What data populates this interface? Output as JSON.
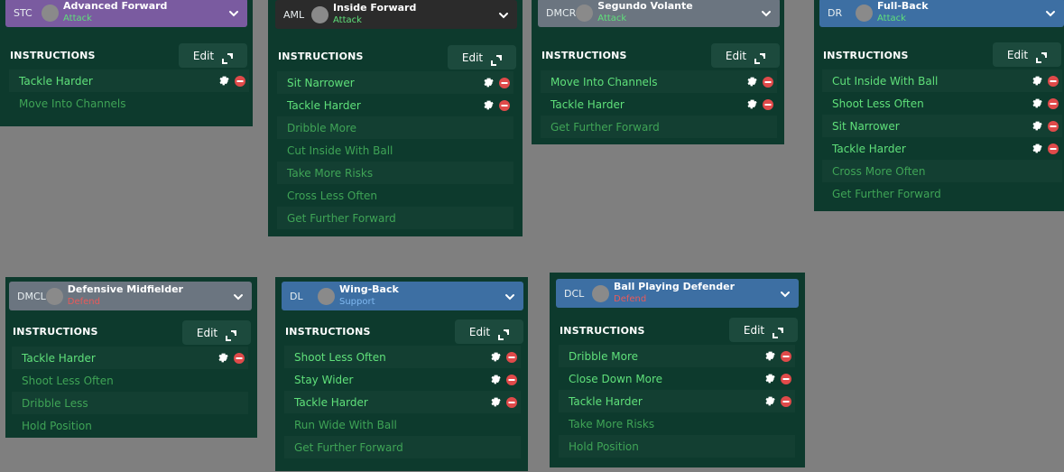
{
  "colors": {
    "attack": "#5fe07a",
    "support": "#7fb8f0",
    "defend": "#e85a5a",
    "active_instruction": "#5fe07a",
    "inactive_instruction": "#3fa456",
    "remove": "#e04a4a"
  },
  "icons": {
    "avatar": "player-avatar-icon",
    "chevron": "chevron-down-icon",
    "edit": "expand-icon",
    "settings": "gear-icon",
    "remove": "remove-icon"
  },
  "panels": [
    {
      "id": "stc",
      "position": "STC",
      "role": "Advanced Forward",
      "duty": "Attack",
      "duty_color": "#5fe07a",
      "header_color": "#7a5ba0",
      "instructions_label": "INSTRUCTIONS",
      "edit_label": "Edit",
      "instructions": [
        {
          "label": "Tackle Harder",
          "active": true
        },
        {
          "label": "Move Into Channels",
          "active": false
        }
      ]
    },
    {
      "id": "aml",
      "position": "AML",
      "role": "Inside Forward",
      "duty": "Attack",
      "duty_color": "#5fe07a",
      "header_color": "#2b2b2b",
      "instructions_label": "INSTRUCTIONS",
      "edit_label": "Edit",
      "instructions": [
        {
          "label": "Sit Narrower",
          "active": true
        },
        {
          "label": "Tackle Harder",
          "active": true
        },
        {
          "label": "Dribble More",
          "active": false
        },
        {
          "label": "Cut Inside With Ball",
          "active": false
        },
        {
          "label": "Take More Risks",
          "active": false
        },
        {
          "label": "Cross Less Often",
          "active": false
        },
        {
          "label": "Get Further Forward",
          "active": false
        }
      ]
    },
    {
      "id": "dmcr",
      "position": "DMCR",
      "role": "Segundo Volante",
      "duty": "Attack",
      "duty_color": "#5fe07a",
      "header_color": "#6b7580",
      "instructions_label": "INSTRUCTIONS",
      "edit_label": "Edit",
      "instructions": [
        {
          "label": "Move Into Channels",
          "active": true
        },
        {
          "label": "Tackle Harder",
          "active": true
        },
        {
          "label": "Get Further Forward",
          "active": false
        }
      ]
    },
    {
      "id": "dr",
      "position": "DR",
      "role": "Full-Back",
      "duty": "Attack",
      "duty_color": "#5fe07a",
      "header_color": "#3d6fa3",
      "instructions_label": "INSTRUCTIONS",
      "edit_label": "Edit",
      "instructions": [
        {
          "label": "Cut Inside With Ball",
          "active": true
        },
        {
          "label": "Shoot Less Often",
          "active": true
        },
        {
          "label": "Sit Narrower",
          "active": true
        },
        {
          "label": "Tackle Harder",
          "active": true
        },
        {
          "label": "Cross More Often",
          "active": false
        },
        {
          "label": "Get Further Forward",
          "active": false
        }
      ]
    },
    {
      "id": "dmcl",
      "position": "DMCL",
      "role": "Defensive Midfielder",
      "duty": "Defend",
      "duty_color": "#e85a5a",
      "header_color": "#6b7580",
      "instructions_label": "INSTRUCTIONS",
      "edit_label": "Edit",
      "instructions": [
        {
          "label": "Tackle Harder",
          "active": true
        },
        {
          "label": "Shoot Less Often",
          "active": false
        },
        {
          "label": "Dribble Less",
          "active": false
        },
        {
          "label": "Hold Position",
          "active": false
        }
      ]
    },
    {
      "id": "dl",
      "position": "DL",
      "role": "Wing-Back",
      "duty": "Support",
      "duty_color": "#7fb8f0",
      "header_color": "#3d6fa3",
      "instructions_label": "INSTRUCTIONS",
      "edit_label": "Edit",
      "instructions": [
        {
          "label": "Shoot Less Often",
          "active": true
        },
        {
          "label": "Stay Wider",
          "active": true
        },
        {
          "label": "Tackle Harder",
          "active": true
        },
        {
          "label": "Run Wide With Ball",
          "active": false
        },
        {
          "label": "Get Further Forward",
          "active": false
        }
      ]
    },
    {
      "id": "dcl",
      "position": "DCL",
      "role": "Ball Playing Defender",
      "duty": "Defend",
      "duty_color": "#e85a5a",
      "header_color": "#3d6fa3",
      "instructions_label": "INSTRUCTIONS",
      "edit_label": "Edit",
      "instructions": [
        {
          "label": "Dribble More",
          "active": true
        },
        {
          "label": "Close Down More",
          "active": true
        },
        {
          "label": "Tackle Harder",
          "active": true
        },
        {
          "label": "Take More Risks",
          "active": false
        },
        {
          "label": "Hold Position",
          "active": false
        }
      ]
    }
  ]
}
